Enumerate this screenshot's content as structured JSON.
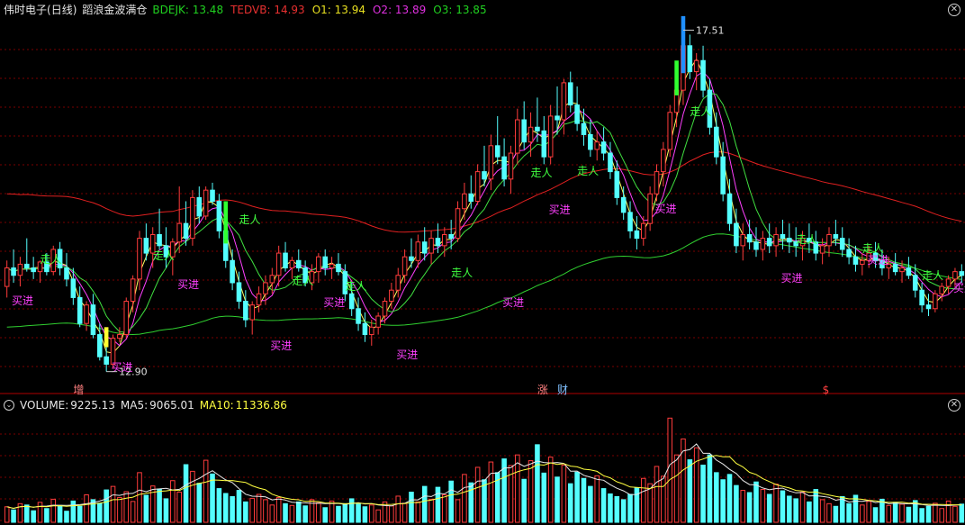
{
  "main_header": {
    "stock_name": "伟时电子",
    "period": "(日线)",
    "indicator_name": "蹈浪金波满仓",
    "values": [
      {
        "label": "BDEJK:",
        "value": "13.48",
        "color": "#20d020"
      },
      {
        "label": "TEDVB:",
        "value": "14.93",
        "color": "#e83030"
      },
      {
        "label": "O1:",
        "value": "13.94",
        "color": "#e8e020"
      },
      {
        "label": "O2:",
        "value": "13.89",
        "color": "#e030e0"
      },
      {
        "label": "O3:",
        "value": "13.85",
        "color": "#20d020"
      }
    ]
  },
  "volume_header": {
    "volume_label": "VOLUME:",
    "volume_value": "9225.13",
    "ma5_label": "MA5:",
    "ma5_value": "9065.01",
    "ma10_label": "MA10:",
    "ma10_value": "11336.86"
  },
  "annotations": {
    "high_price": "17.51",
    "low_price": "12.90",
    "buy_label": "买进",
    "walk_label": "走人"
  },
  "event_markers": [
    {
      "text": "增",
      "color": "#ff8080"
    },
    {
      "text": "涨",
      "color": "#ff8080"
    },
    {
      "text": "财",
      "color": "#80c0ff"
    },
    {
      "text": "$",
      "color": "#ff4040"
    }
  ],
  "colors": {
    "up": "#ff3c3c",
    "down": "#54ffff",
    "ma_yellow": "#ffff60",
    "ma_magenta": "#ff40ff",
    "ma_green": "#40e040",
    "slow_red": "#e02020",
    "slow_green": "#30d030",
    "buy_text": "#ff40ff",
    "walk_text": "#40ff40",
    "grid": "#7a0000"
  },
  "chart_data": {
    "type": "candlestick",
    "price_range": [
      12.9,
      17.51
    ],
    "grid": true,
    "candles": [
      [
        14.05,
        14.4,
        13.9,
        14.3
      ],
      [
        14.3,
        14.55,
        14.1,
        14.2
      ],
      [
        14.2,
        14.45,
        14.05,
        14.35
      ],
      [
        14.35,
        14.7,
        14.25,
        14.3
      ],
      [
        14.3,
        14.45,
        14.15,
        14.25
      ],
      [
        14.25,
        14.4,
        14.1,
        14.38
      ],
      [
        14.38,
        14.5,
        14.2,
        14.25
      ],
      [
        14.25,
        14.6,
        14.2,
        14.55
      ],
      [
        14.55,
        14.65,
        14.2,
        14.3
      ],
      [
        14.3,
        14.5,
        14.05,
        14.15
      ],
      [
        14.15,
        14.3,
        13.8,
        13.9
      ],
      [
        13.9,
        14.05,
        13.5,
        13.55
      ],
      [
        13.55,
        13.85,
        13.45,
        13.8
      ],
      [
        13.8,
        13.95,
        13.35,
        13.4
      ],
      [
        13.4,
        13.55,
        13.05,
        13.1
      ],
      [
        13.1,
        13.25,
        12.9,
        13.0
      ],
      [
        13.0,
        13.4,
        12.95,
        13.35
      ],
      [
        13.35,
        13.5,
        13.3,
        13.4
      ],
      [
        13.4,
        13.9,
        13.35,
        13.85
      ],
      [
        13.85,
        14.2,
        13.7,
        14.15
      ],
      [
        14.15,
        14.8,
        14.0,
        14.7
      ],
      [
        14.7,
        14.9,
        14.4,
        14.5
      ],
      [
        14.5,
        14.85,
        14.3,
        14.75
      ],
      [
        14.75,
        15.1,
        14.55,
        14.6
      ],
      [
        14.6,
        14.85,
        14.3,
        14.45
      ],
      [
        14.45,
        14.7,
        14.2,
        14.65
      ],
      [
        14.65,
        15.4,
        14.5,
        14.9
      ],
      [
        14.9,
        15.2,
        14.6,
        14.7
      ],
      [
        14.7,
        15.35,
        14.6,
        15.25
      ],
      [
        15.25,
        15.4,
        14.9,
        15.0
      ],
      [
        15.0,
        15.4,
        14.95,
        15.35
      ],
      [
        15.35,
        15.45,
        15.15,
        15.2
      ],
      [
        15.2,
        15.3,
        14.7,
        14.8
      ],
      [
        14.8,
        14.95,
        14.3,
        14.4
      ],
      [
        14.4,
        14.55,
        14.0,
        14.1
      ],
      [
        14.1,
        14.25,
        13.75,
        13.85
      ],
      [
        13.85,
        14.0,
        13.5,
        13.6
      ],
      [
        13.6,
        13.85,
        13.4,
        13.8
      ],
      [
        13.8,
        14.05,
        13.7,
        13.95
      ],
      [
        13.95,
        14.2,
        13.8,
        14.1
      ],
      [
        14.1,
        14.3,
        13.95,
        14.2
      ],
      [
        14.2,
        14.6,
        14.05,
        14.5
      ],
      [
        14.5,
        14.65,
        14.25,
        14.3
      ],
      [
        14.3,
        14.45,
        14.15,
        14.4
      ],
      [
        14.4,
        14.55,
        14.25,
        14.3
      ],
      [
        14.3,
        14.4,
        14.05,
        14.1
      ],
      [
        14.1,
        14.35,
        14.0,
        14.25
      ],
      [
        14.25,
        14.5,
        14.1,
        14.45
      ],
      [
        14.45,
        14.55,
        14.2,
        14.3
      ],
      [
        14.3,
        14.45,
        14.15,
        14.35
      ],
      [
        14.35,
        14.5,
        14.2,
        14.25
      ],
      [
        14.25,
        14.35,
        13.85,
        13.95
      ],
      [
        13.95,
        14.1,
        13.65,
        13.75
      ],
      [
        13.75,
        13.9,
        13.45,
        13.55
      ],
      [
        13.55,
        13.7,
        13.3,
        13.4
      ],
      [
        13.4,
        13.6,
        13.25,
        13.5
      ],
      [
        13.5,
        13.7,
        13.4,
        13.65
      ],
      [
        13.65,
        13.9,
        13.55,
        13.85
      ],
      [
        13.85,
        14.1,
        13.75,
        14.0
      ],
      [
        14.0,
        14.3,
        13.9,
        14.2
      ],
      [
        14.2,
        14.55,
        14.1,
        14.45
      ],
      [
        14.45,
        14.7,
        14.3,
        14.4
      ],
      [
        14.4,
        14.75,
        14.3,
        14.65
      ],
      [
        14.65,
        14.85,
        14.4,
        14.5
      ],
      [
        14.5,
        14.8,
        14.35,
        14.7
      ],
      [
        14.7,
        14.9,
        14.5,
        14.6
      ],
      [
        14.6,
        14.85,
        14.45,
        14.75
      ],
      [
        14.75,
        14.95,
        14.55,
        14.7
      ],
      [
        14.7,
        15.2,
        14.65,
        15.1
      ],
      [
        15.1,
        15.45,
        14.95,
        15.3
      ],
      [
        15.3,
        15.55,
        15.1,
        15.2
      ],
      [
        15.2,
        15.7,
        15.15,
        15.6
      ],
      [
        15.6,
        15.95,
        15.4,
        15.5
      ],
      [
        15.5,
        16.1,
        15.35,
        15.95
      ],
      [
        15.95,
        16.35,
        15.7,
        15.8
      ],
      [
        15.8,
        16.05,
        15.4,
        15.5
      ],
      [
        15.5,
        15.95,
        15.3,
        15.85
      ],
      [
        15.85,
        16.45,
        15.7,
        16.3
      ],
      [
        16.3,
        16.55,
        15.9,
        16.0
      ],
      [
        16.0,
        16.4,
        15.8,
        16.2
      ],
      [
        16.2,
        16.6,
        16.0,
        16.15
      ],
      [
        16.15,
        16.35,
        15.7,
        15.8
      ],
      [
        15.8,
        16.5,
        15.7,
        16.35
      ],
      [
        16.35,
        16.75,
        16.1,
        16.3
      ],
      [
        16.3,
        16.85,
        16.1,
        16.8
      ],
      [
        16.8,
        16.95,
        16.4,
        16.5
      ],
      [
        16.5,
        16.75,
        16.15,
        16.25
      ],
      [
        16.25,
        16.45,
        15.95,
        16.1
      ],
      [
        16.1,
        16.3,
        15.8,
        15.9
      ],
      [
        15.9,
        16.15,
        15.75,
        16.0
      ],
      [
        16.0,
        16.2,
        15.75,
        15.85
      ],
      [
        15.85,
        16.0,
        15.5,
        15.6
      ],
      [
        15.6,
        15.75,
        15.15,
        15.25
      ],
      [
        15.25,
        15.4,
        14.95,
        15.05
      ],
      [
        15.05,
        15.2,
        14.7,
        14.8
      ],
      [
        14.8,
        15.0,
        14.55,
        14.7
      ],
      [
        14.7,
        15.0,
        14.6,
        14.9
      ],
      [
        14.9,
        15.4,
        14.8,
        15.3
      ],
      [
        15.3,
        15.7,
        15.2,
        15.6
      ],
      [
        15.6,
        16.0,
        15.4,
        15.9
      ],
      [
        15.9,
        16.5,
        15.8,
        16.4
      ],
      [
        16.4,
        16.9,
        16.2,
        16.7
      ],
      [
        16.7,
        17.51,
        16.5,
        17.3
      ],
      [
        17.3,
        17.45,
        16.85,
        16.95
      ],
      [
        16.95,
        17.2,
        16.7,
        17.1
      ],
      [
        17.1,
        17.3,
        16.6,
        16.7
      ],
      [
        16.7,
        16.85,
        16.1,
        16.2
      ],
      [
        16.2,
        16.4,
        15.7,
        15.8
      ],
      [
        15.8,
        16.0,
        15.2,
        15.3
      ],
      [
        15.3,
        15.5,
        14.8,
        14.9
      ],
      [
        14.9,
        15.1,
        14.5,
        14.6
      ],
      [
        14.6,
        14.9,
        14.4,
        14.75
      ],
      [
        14.75,
        14.95,
        14.55,
        14.65
      ],
      [
        14.65,
        14.85,
        14.45,
        14.55
      ],
      [
        14.55,
        14.8,
        14.4,
        14.7
      ],
      [
        14.7,
        14.9,
        14.5,
        14.6
      ],
      [
        14.6,
        14.85,
        14.45,
        14.75
      ],
      [
        14.75,
        14.95,
        14.55,
        14.7
      ],
      [
        14.7,
        14.9,
        14.5,
        14.65
      ],
      [
        14.65,
        14.85,
        14.45,
        14.6
      ],
      [
        14.6,
        14.8,
        14.4,
        14.7
      ],
      [
        14.7,
        14.9,
        14.5,
        14.65
      ],
      [
        14.65,
        14.8,
        14.4,
        14.5
      ],
      [
        14.5,
        14.7,
        14.35,
        14.6
      ],
      [
        14.6,
        14.85,
        14.45,
        14.75
      ],
      [
        14.75,
        14.95,
        14.6,
        14.7
      ],
      [
        14.7,
        14.85,
        14.45,
        14.55
      ],
      [
        14.55,
        14.7,
        14.35,
        14.45
      ],
      [
        14.45,
        14.6,
        14.25,
        14.35
      ],
      [
        14.35,
        14.5,
        14.2,
        14.4
      ],
      [
        14.4,
        14.6,
        14.3,
        14.5
      ],
      [
        14.5,
        14.65,
        14.3,
        14.4
      ],
      [
        14.4,
        14.55,
        14.2,
        14.3
      ],
      [
        14.3,
        14.45,
        14.15,
        14.35
      ],
      [
        14.35,
        14.5,
        14.2,
        14.25
      ],
      [
        14.25,
        14.4,
        14.1,
        14.3
      ],
      [
        14.3,
        14.45,
        14.15,
        14.2
      ],
      [
        14.2,
        14.35,
        13.9,
        14.0
      ],
      [
        14.0,
        14.1,
        13.7,
        13.8
      ],
      [
        13.8,
        13.95,
        13.65,
        13.75
      ],
      [
        13.75,
        14.0,
        13.7,
        13.95
      ],
      [
        13.95,
        14.1,
        13.85,
        14.05
      ],
      [
        14.05,
        14.2,
        13.95,
        14.15
      ],
      [
        14.15,
        14.3,
        14.05,
        14.25
      ],
      [
        14.25,
        14.35,
        14.1,
        14.2
      ]
    ],
    "volume": [
      3500,
      2800,
      4200,
      3900,
      2600,
      4500,
      3100,
      5200,
      3800,
      2500,
      4800,
      3600,
      6200,
      5100,
      4300,
      7300,
      8100,
      5600,
      6900,
      4700,
      11200,
      6100,
      8200,
      7500,
      5300,
      9400,
      6800,
      13000,
      11500,
      8800,
      14000,
      10900,
      7600,
      6500,
      5800,
      7200,
      4600,
      5400,
      6300,
      5100,
      3900,
      5600,
      4200,
      3800,
      4600,
      3700,
      5100,
      4400,
      3300,
      4800,
      3600,
      4200,
      5300,
      4100,
      3500,
      3900,
      2800,
      4600,
      3700,
      5900,
      4300,
      6800,
      4600,
      8100,
      5200,
      7900,
      6200,
      9300,
      5100,
      10800,
      8900,
      12400,
      9600,
      13600,
      11200,
      14300,
      12800,
      15200,
      9700,
      13900,
      17500,
      11100,
      14700,
      10200,
      12900,
      8700,
      11300,
      9900,
      8100,
      10500,
      7600,
      6400,
      5800,
      5100,
      6300,
      7800,
      9900,
      8700,
      12600,
      10400,
      23500,
      15200,
      18800,
      14100,
      16800,
      12900,
      15200,
      11200,
      9600,
      10800,
      8300,
      7200,
      6700,
      9100,
      7400,
      6300,
      8600,
      7100,
      5900,
      5300,
      6800,
      4600,
      7400,
      5100,
      4200,
      3600,
      5800,
      4200,
      6100,
      3900,
      4700,
      3300,
      5200,
      3800,
      4500,
      4100,
      3400,
      4900,
      3100,
      3600,
      4300,
      3100,
      4800,
      3600,
      4100
    ]
  }
}
